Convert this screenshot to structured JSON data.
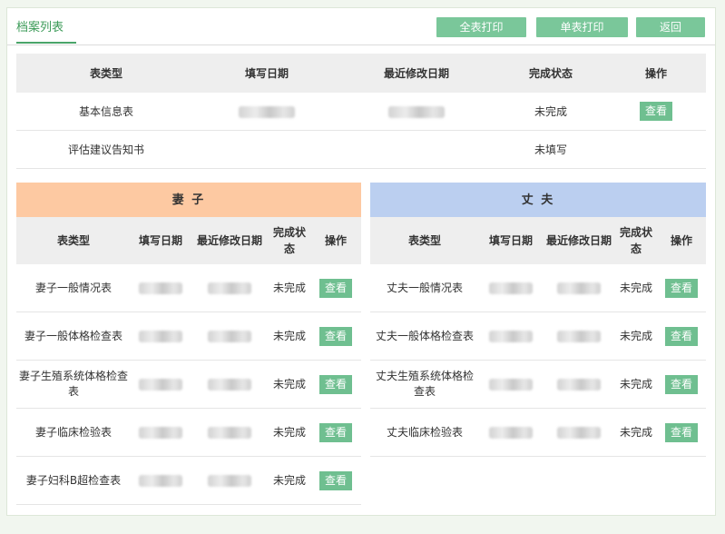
{
  "tab_label": "档案列表",
  "buttons": {
    "print_all": "全表打印",
    "print_single": "单表打印",
    "back": "返回"
  },
  "main_table": {
    "headers": [
      "表类型",
      "填写日期",
      "最近修改日期",
      "完成状态",
      "操作"
    ],
    "rows": [
      {
        "type": "基本信息表",
        "status": "未完成",
        "action": "查看"
      },
      {
        "type": "评估建议告知书",
        "status": "未填写"
      }
    ]
  },
  "wife": {
    "title": "妻 子",
    "color": "#fdc9a2",
    "headers": [
      "表类型",
      "填写日期",
      "最近修改日期",
      "完成状态",
      "操作"
    ],
    "rows": [
      {
        "type": "妻子一般情况表",
        "status": "未完成",
        "action": "查看"
      },
      {
        "type": "妻子一般体格检查表",
        "status": "未完成",
        "action": "查看"
      },
      {
        "type": "妻子生殖系统体格检查表",
        "status": "未完成",
        "action": "查看"
      },
      {
        "type": "妻子临床检验表",
        "status": "未完成",
        "action": "查看"
      },
      {
        "type": "妻子妇科B超检查表",
        "status": "未完成",
        "action": "查看"
      }
    ]
  },
  "husband": {
    "title": "丈 夫",
    "color": "#bbcff0",
    "headers": [
      "表类型",
      "填写日期",
      "最近修改日期",
      "完成状态",
      "操作"
    ],
    "rows": [
      {
        "type": "丈夫一般情况表",
        "status": "未完成",
        "action": "查看"
      },
      {
        "type": "丈夫一般体格检查表",
        "status": "未完成",
        "action": "查看"
      },
      {
        "type": "丈夫生殖系统体格检查表",
        "status": "未完成",
        "action": "查看"
      },
      {
        "type": "丈夫临床检验表",
        "status": "未完成",
        "action": "查看"
      }
    ]
  },
  "colors": {
    "accent": "#4aa56a",
    "button": "#7ac79a"
  }
}
